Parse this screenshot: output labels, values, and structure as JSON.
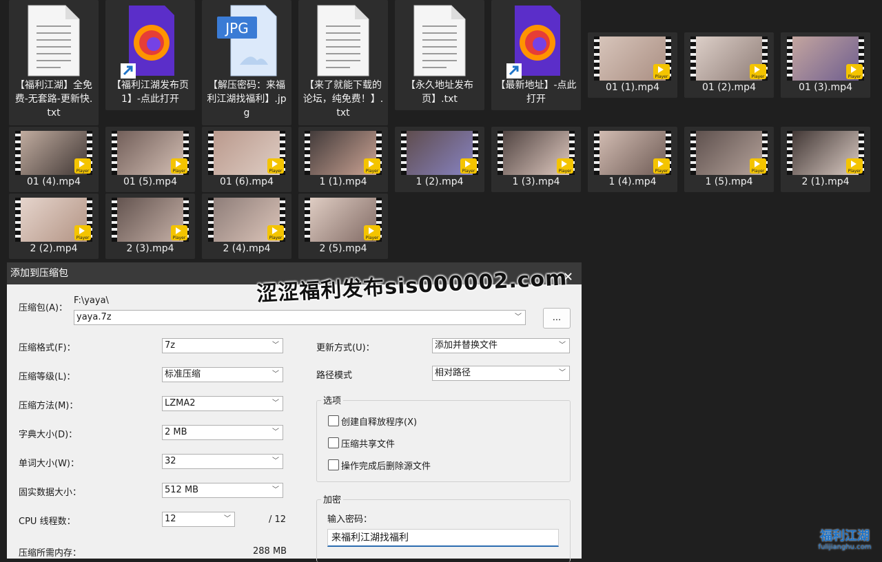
{
  "files": {
    "doc1": "【福利江湖】全免费-无套路-更新快.txt",
    "doc2": "【福利江湖发布页1】-点此打开",
    "doc3": "【解压密码：来福利江湖找福利】.jpg",
    "doc4": "【来了就能下载的论坛，纯免费！】.txt",
    "doc5": "【永久地址发布页】.txt",
    "doc6": "【最新地址】-点此打开",
    "v1": "01 (1).mp4",
    "v2": "01 (2).mp4",
    "v3": "01 (3).mp4",
    "v4": "01 (4).mp4",
    "v5": "01 (5).mp4",
    "v6": "01 (6).mp4",
    "v7": "1 (1).mp4",
    "v8": "1 (2).mp4",
    "v9": "1 (3).mp4",
    "v10": "1 (4).mp4",
    "v11": "1 (5).mp4",
    "v12": "2 (1).mp4",
    "v13": "2 (2).mp4",
    "v14": "2 (3).mp4",
    "v15": "2 (4).mp4",
    "v16": "2 (5).mp4",
    "jpg_badge": "JPG",
    "player_badge": "Player"
  },
  "dialog": {
    "title": "添加到压缩包",
    "archive_label": "压缩包(A)：",
    "archive_path": "F:\\yaya\\",
    "archive_name": "yaya.7z",
    "browse_button": "...",
    "format_label": "压缩格式(F)：",
    "format_value": "7z",
    "level_label": "压缩等级(L)：",
    "level_value": "标准压缩",
    "method_label": "压缩方法(M)：",
    "method_value": "LZMA2",
    "dict_label": "字典大小(D)：",
    "dict_value": "2 MB",
    "word_label": "单词大小(W)：",
    "word_value": "32",
    "solid_label": "固实数据大小：",
    "solid_value": "512 MB",
    "cpu_label": "CPU 线程数：",
    "cpu_value": "12",
    "cpu_total": "/ 12",
    "mem_label": "压缩所需内存：",
    "mem_value": "288 MB",
    "update_label": "更新方式(U)：",
    "update_value": "添加并替换文件",
    "path_label": "路径模式",
    "path_value": "相对路径",
    "options_title": "选项",
    "opt_sfx": "创建自释放程序(X)",
    "opt_shared": "压缩共享文件",
    "opt_delete": "操作完成后删除源文件",
    "encrypt_title": "加密",
    "password_label": "输入密码：",
    "password_value": "来福利江湖找福利"
  },
  "watermark": "涩涩福利发布sis000002.com",
  "logo": {
    "main": "福利江湖",
    "sub": "fulijianghu.com"
  }
}
